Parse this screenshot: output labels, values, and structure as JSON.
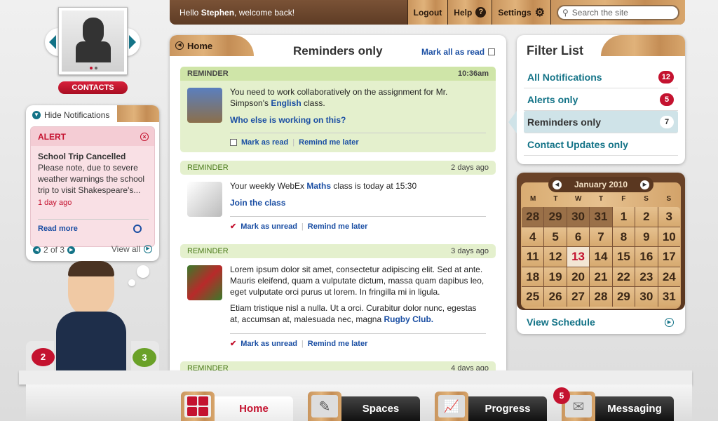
{
  "topbar": {
    "greeting_prefix": "Hello ",
    "user": "Stephen",
    "greeting_suffix": ", welcome back!",
    "logout": "Logout",
    "help": "Help",
    "settings": "Settings",
    "search_placeholder": "Search the site"
  },
  "contacts": {
    "label": "CONTACTS"
  },
  "notifications": {
    "toggle": "Hide Notifications",
    "type": "ALERT",
    "title": "School Trip Cancelled",
    "body": "Please note, due to severe weather warnings the school trip to visit Shakespeare's...",
    "time": "1 day ago",
    "read_more": "Read more",
    "pager": "2 of 3",
    "view_all": "View all"
  },
  "bubbles": {
    "red": "2",
    "green": "3"
  },
  "main": {
    "home_tab": "Home",
    "title": "Reminders only",
    "mark_all": "Mark all as read",
    "reminders": [
      {
        "type": "REMINDER",
        "time": "10:36am",
        "text_a": "You need to work collaboratively on the assignment for Mr. Simpson's ",
        "link": "English",
        "text_b": " class.",
        "cta": "Who else is working on this?",
        "action1": "Mark as read",
        "action2": "Remind me later"
      },
      {
        "type": "REMINDER",
        "time": "2 days ago",
        "text_a": "Your weekly WebEx ",
        "link": "Maths",
        "text_b": " class is today at 15:30",
        "cta": "Join the class",
        "action1": "Mark as unread",
        "action2": "Remind me later"
      },
      {
        "type": "REMINDER",
        "time": "3 days ago",
        "text_a": "Lorem ipsum dolor sit amet, consectetur adipiscing elit. Sed at ante. Mauris eleifend, quam a vulputate dictum, massa quam dapibus leo, eget vulputate orci purus ut lorem. In fringilla mi in ligula.",
        "text_c": "Etiam tristique nisl a nulla. Ut a orci. Curabitur dolor nunc, egestas at, accumsan at, malesuada nec, magna ",
        "link": "Rugby Club.",
        "action1": "Mark as unread",
        "action2": "Remind me later"
      },
      {
        "type": "REMINDER",
        "time": "4 days ago"
      }
    ]
  },
  "filter": {
    "title": "Filter List",
    "items": [
      {
        "label": "All Notifications",
        "count": "12"
      },
      {
        "label": "Alerts only",
        "count": "5"
      },
      {
        "label": "Reminders only",
        "count": "7"
      },
      {
        "label": "Contact Updates only"
      }
    ]
  },
  "calendar": {
    "month": "January 2010",
    "days_of_week": [
      "M",
      "T",
      "W",
      "T",
      "F",
      "S",
      "S"
    ],
    "prev_month_days": [
      "28",
      "29",
      "30",
      "31"
    ],
    "days": [
      "1",
      "2",
      "3",
      "4",
      "5",
      "6",
      "7",
      "8",
      "9",
      "10",
      "11",
      "12",
      "13",
      "14",
      "15",
      "16",
      "17",
      "18",
      "19",
      "20",
      "21",
      "22",
      "23",
      "24",
      "25",
      "26",
      "27",
      "28",
      "29",
      "30",
      "31"
    ],
    "today": "13",
    "view_schedule": "View Schedule"
  },
  "nav": {
    "home": "Home",
    "spaces": "Spaces",
    "progress": "Progress",
    "messaging": "Messaging",
    "messaging_badge": "5"
  },
  "colors": {
    "accent_red": "#c4122f",
    "teal": "#137387",
    "link_blue": "#1a4ea3",
    "reminder_green": "#cfe5a8",
    "wood": "#d6a96f"
  }
}
